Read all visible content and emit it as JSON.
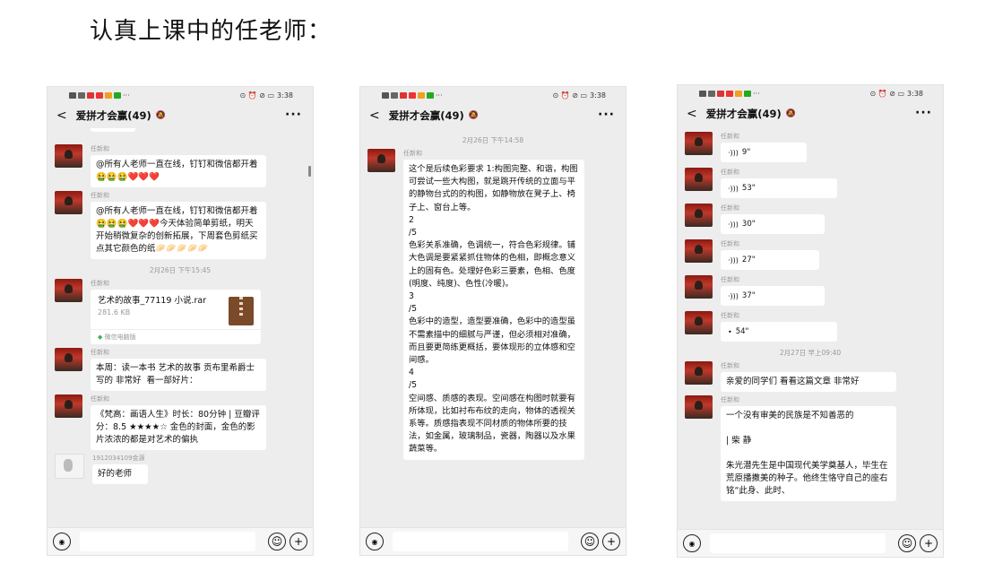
{
  "heading": "认真上课中的任老师：",
  "status": {
    "time": "3:38"
  },
  "chat_title": "爱拼才会赢(49)",
  "input_bar": {
    "placeholder": ""
  },
  "phones": [
    {
      "messages": [
        {
          "kind": "text",
          "sender": "任新和",
          "text": "@所有人老师一直在线，钉钉和微信都开着🤮🤮🤮❤️❤️❤️"
        },
        {
          "kind": "text",
          "sender": "任新和",
          "text": "@所有人老师一直在线，钉钉和微信都开着🤮🤮🤮❤️❤️❤️今天体验简单剪纸，明天开始稍微复杂的创新拓展，下周套色剪纸买点其它颜色的纸🥟🥟🥟🥟🥟"
        },
        {
          "kind": "time",
          "text": "2月26日 下午15:45"
        },
        {
          "kind": "file",
          "sender": "任新和",
          "name": "艺术的故事_77119 小说.rar",
          "size": "281.6 KB",
          "source": "微信电脑版"
        },
        {
          "kind": "text",
          "sender": "任新和",
          "text": "本周：读一本书 艺术的故事 贡布里希爵士写的 非常好  看一部好片："
        },
        {
          "kind": "text",
          "sender": "任新和",
          "text": "《梵高：画语人生》时长：80分钟 | 豆瓣评分：8.5 ★★★★☆ 金色的封面，金色的影片浓浓的都是对艺术的偏执"
        },
        {
          "kind": "text",
          "sender": "1912034109金源",
          "alt": true,
          "text": "好的老师"
        }
      ]
    },
    {
      "messages": [
        {
          "kind": "time",
          "text": "2月26日 下午14:58"
        },
        {
          "kind": "text",
          "sender": "任新和",
          "text": "这个是后续色彩要求 1:构图完整、和谐，构图可尝试一些大构图，就是跳开传统的立面与平的静物台式的的构图，如静物放在凳子上、椅子上、窗台上等。\n2\n/5\n色彩关系准确，色调统一，符合色彩规律。铺大色调是要紧紧抓住物体的色相，即概念意义上的固有色。处理好色彩三要素，色相、色度(明度、纯度)、色性(冷暖)。\n3\n/5\n色彩中的造型，造型要准确，色彩中的造型虽不需素描中的细腻与严谨，但必须相对准确，而且要更简练更概括，要体现形的立体感和空间感。\n4\n/5\n空间感、质感的表现。空间感在构图时就要有所体现，比如衬布布纹的走向，物体的透视关系等。质感指表现不同材质的物体所要的技法，如金属，玻璃制品，瓷器，陶器以及水果蔬菜等。"
        }
      ]
    },
    {
      "messages": [
        {
          "kind": "voice",
          "sender": "任新和",
          "text": "9\"",
          "w": 96
        },
        {
          "kind": "voice",
          "sender": "任新和",
          "text": "53\"",
          "w": 130
        },
        {
          "kind": "voice",
          "sender": "任新和",
          "text": "30\"",
          "w": 116
        },
        {
          "kind": "voice",
          "sender": "任新和",
          "text": "27\"",
          "w": 110
        },
        {
          "kind": "voice",
          "sender": "任新和",
          "text": "37\"",
          "w": 116
        },
        {
          "kind": "voice",
          "sender": "任新和",
          "text": "54\"",
          "w": 130,
          "dot": true
        },
        {
          "kind": "time",
          "text": "2月27日 早上09:40"
        },
        {
          "kind": "text",
          "sender": "任新和",
          "text": "亲爱的同学们 看看这篇文章 非常好"
        },
        {
          "kind": "text",
          "sender": "任新和",
          "text": "一个没有审美的民族是不知善恶的\n\n| 柴 静\n\n朱光潜先生是中国现代美学奠基人，毕生在荒原播撒美的种子。他终生恪守自己的座右铭“此身、此时、"
        }
      ]
    }
  ]
}
